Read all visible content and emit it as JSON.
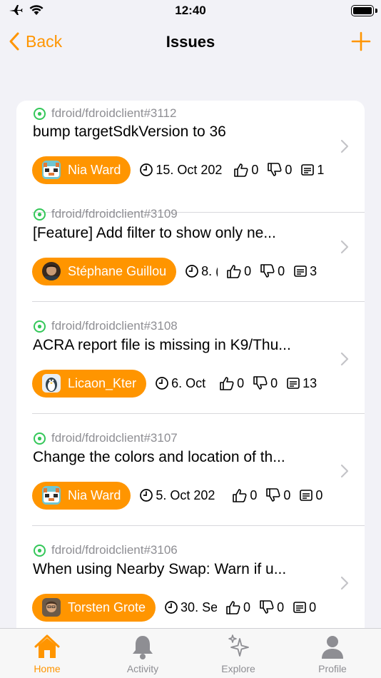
{
  "status_bar": {
    "time": "12:40"
  },
  "nav": {
    "back_label": "Back",
    "title": "Issues"
  },
  "colors": {
    "accent": "#ff9500",
    "open_icon": "#34c759",
    "muted": "#8e8e93"
  },
  "issues": [
    {
      "repo": "fdroid/fdroidclient#3112",
      "title": "bump targetSdkVersion to 36",
      "author": "Nia Ward",
      "avatar": "tiger-avatar",
      "date": "15. Oct 202",
      "likes": "0",
      "dislikes": "0",
      "comments": "1"
    },
    {
      "repo": "fdroid/fdroidclient#3109",
      "title": "[Feature] Add filter to show only ne...",
      "author": "Stéphane Guillou",
      "avatar": "photo-avatar",
      "date": "8. (",
      "likes": "0",
      "dislikes": "0",
      "comments": "3"
    },
    {
      "repo": "fdroid/fdroidclient#3108",
      "title": "ACRA report file is missing in K9/Thu...",
      "author": "Licaon_Kter",
      "avatar": "penguin-avatar",
      "date": "6. Oct",
      "likes": "0",
      "dislikes": "0",
      "comments": "13"
    },
    {
      "repo": "fdroid/fdroidclient#3107",
      "title": "Change the colors and location of th...",
      "author": "Nia Ward",
      "avatar": "tiger-avatar",
      "date": "5. Oct 202",
      "likes": "0",
      "dislikes": "0",
      "comments": "0"
    },
    {
      "repo": "fdroid/fdroidclient#3106",
      "title": "When using Nearby Swap: Warn if u...",
      "author": "Torsten Grote",
      "avatar": "photo-avatar",
      "date": "30. Se",
      "likes": "0",
      "dislikes": "0",
      "comments": "0"
    }
  ],
  "tabs": [
    {
      "label": "Home",
      "icon": "house-icon",
      "active": true
    },
    {
      "label": "Activity",
      "icon": "bell-icon",
      "active": false
    },
    {
      "label": "Explore",
      "icon": "sparkles-icon",
      "active": false
    },
    {
      "label": "Profile",
      "icon": "person-icon",
      "active": false
    }
  ]
}
